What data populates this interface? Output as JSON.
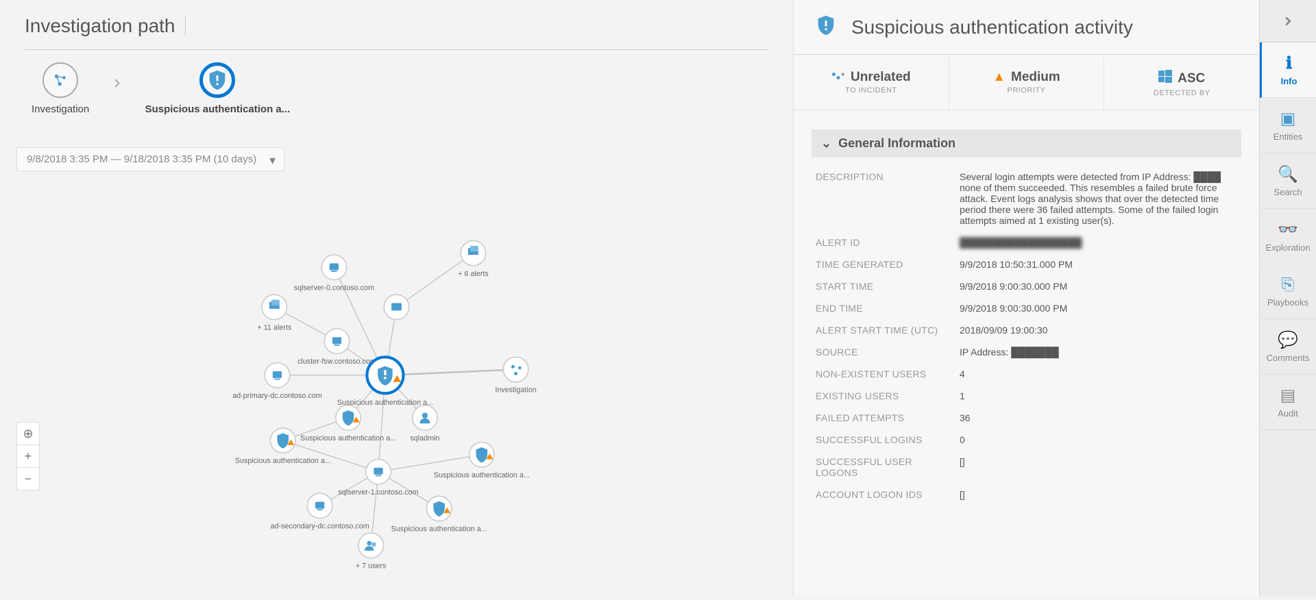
{
  "left": {
    "title": "Investigation path",
    "time_range": "9/8/2018 3:35 PM — 9/18/2018 3:35 PM (10 days)",
    "breadcrumb": {
      "root": "Investigation",
      "current": "Suspicious authentication a..."
    },
    "graph": {
      "nodes": {
        "sqlserver0": {
          "label": "sqlserver-0.contoso.com"
        },
        "alerts6": {
          "label": "+ 6 alerts"
        },
        "alerts11": {
          "label": "+ 11 alerts"
        },
        "clusterfsw": {
          "label": "cluster-fsw.contoso.com"
        },
        "adprimary": {
          "label": "ad-primary-dc.contoso.com"
        },
        "center": {
          "label": "Suspicious authentication a..."
        },
        "investigation": {
          "label": "Investigation"
        },
        "folder": {
          "label": ""
        },
        "sa2": {
          "label": "Suspicious authentication a..."
        },
        "sa3": {
          "label": "Suspicious authentication a..."
        },
        "sqlserver1": {
          "label": "sqlserver-1.contoso.com"
        },
        "sqladmin": {
          "label": "sqladmin"
        },
        "sa4": {
          "label": "Suspicious authentication a..."
        },
        "adsecondary": {
          "label": "ad-secondary-dc.contoso.com"
        },
        "sa5": {
          "label": "Suspicious authentication a..."
        },
        "users7": {
          "label": "+ 7 users"
        }
      }
    },
    "controls": {
      "locate": "⊕",
      "zoom_in": "+",
      "zoom_out": "−"
    }
  },
  "right": {
    "title": "Suspicious authentication activity",
    "meta": {
      "incident": {
        "main": "Unrelated",
        "sub": "TO INCIDENT"
      },
      "priority": {
        "main": "Medium",
        "sub": "PRIORITY"
      },
      "detected": {
        "main": "ASC",
        "sub": "DETECTED BY"
      }
    },
    "section_title": "General Information",
    "fields": {
      "description_label": "DESCRIPTION",
      "description_value": "Several login attempts were detected from IP Address: ████ none of them succeeded. This resembles a failed brute force attack. Event logs analysis shows that over the detected time period there were 36 failed attempts. Some of the failed login attempts aimed at 1 existing user(s).",
      "alert_id_label": "ALERT ID",
      "alert_id_value": "██████████████████",
      "time_generated_label": "TIME GENERATED",
      "time_generated_value": "9/9/2018 10:50:31.000 PM",
      "start_time_label": "START TIME",
      "start_time_value": "9/9/2018 9:00:30.000 PM",
      "end_time_label": "END TIME",
      "end_time_value": "9/9/2018 9:00:30.000 PM",
      "alert_start_utc_label": "ALERT START TIME (UTC)",
      "alert_start_utc_value": "2018/09/09 19:00:30",
      "source_label": "SOURCE",
      "source_value": "IP Address: ███████",
      "nonexistent_label": "NON-EXISTENT USERS",
      "nonexistent_value": "4",
      "existing_label": "EXISTING USERS",
      "existing_value": "1",
      "failed_label": "FAILED ATTEMPTS",
      "failed_value": "36",
      "successful_logins_label": "SUCCESSFUL LOGINS",
      "successful_logins_value": "0",
      "successful_user_logons_label": "SUCCESSFUL USER LOGONS",
      "successful_user_logons_value": "[]",
      "account_logon_ids_label": "ACCOUNT LOGON IDS",
      "account_logon_ids_value": "[]"
    }
  },
  "strip": {
    "tabs": {
      "info": "Info",
      "entities": "Entities",
      "search": "Search",
      "exploration": "Exploration",
      "playbooks": "Playbooks",
      "comments": "Comments",
      "audit": "Audit"
    }
  }
}
